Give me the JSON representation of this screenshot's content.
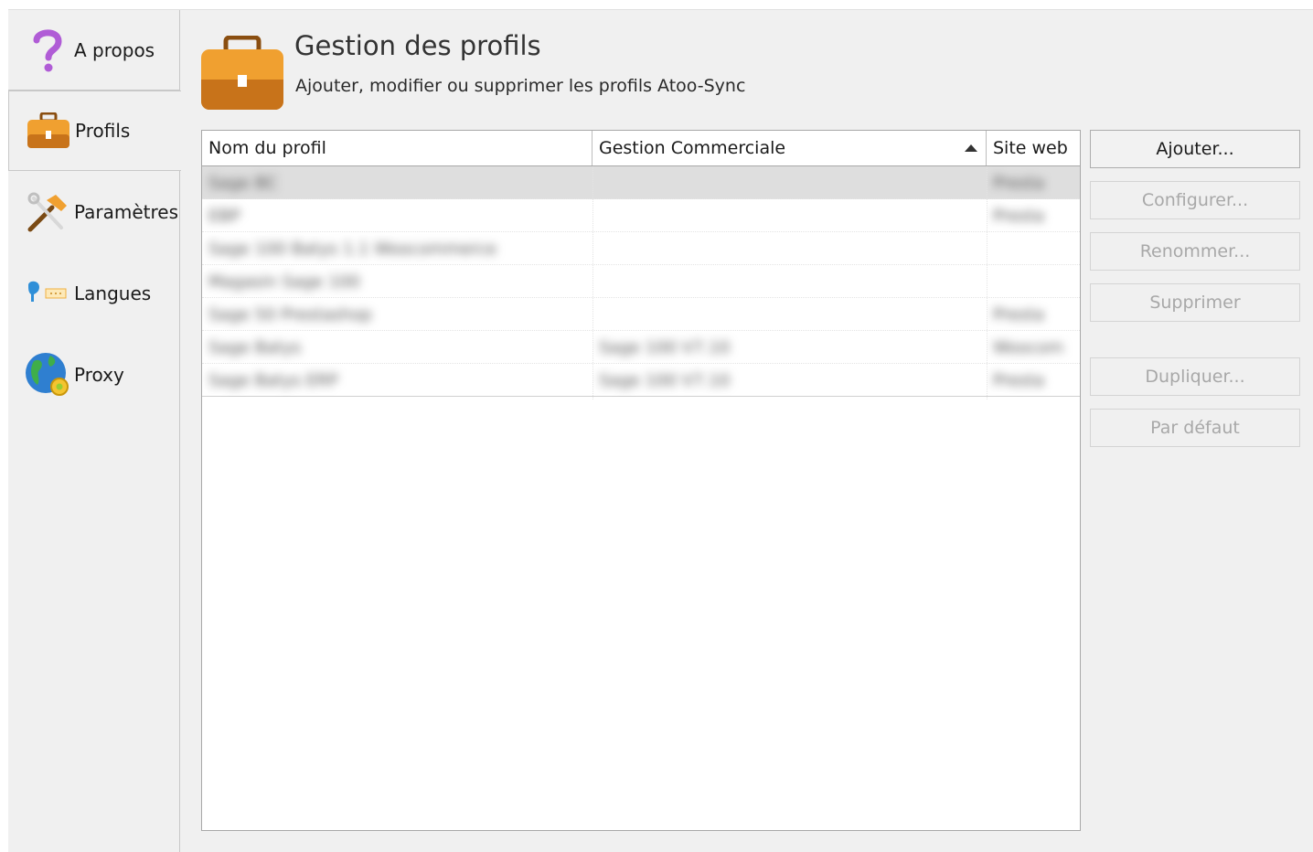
{
  "sidebar": {
    "items": [
      {
        "label": "A propos",
        "icon": "question-icon"
      },
      {
        "label": "Profils",
        "icon": "briefcase-icon",
        "selected": true
      },
      {
        "label": "Paramètres",
        "icon": "tools-icon"
      },
      {
        "label": "Langues",
        "icon": "speech-icon"
      },
      {
        "label": "Proxy",
        "icon": "globe-icon"
      }
    ]
  },
  "header": {
    "title": "Gestion des profils",
    "subtitle": "Ajouter, modifier ou supprimer les profils Atoo-Sync",
    "icon": "briefcase-icon"
  },
  "table": {
    "columns": [
      "Nom du profil",
      "Gestion Commerciale",
      "Site web"
    ],
    "sorted_column": "Gestion Commerciale",
    "sort_direction": "ascending",
    "rows": [
      {
        "name": "Sage BC",
        "gestion": "",
        "site": "Presta",
        "selected": true
      },
      {
        "name": "EBP",
        "gestion": "",
        "site": "Presta"
      },
      {
        "name": "Sage 100 Batys 1.1 Woocommerce",
        "gestion": "",
        "site": ""
      },
      {
        "name": "Magasin Sage 100",
        "gestion": "",
        "site": ""
      },
      {
        "name": "Sage 50 Prestashop",
        "gestion": "",
        "site": "Presta"
      },
      {
        "name": "Sage Batys",
        "gestion": "Sage 100 V7.10",
        "site": "Woocom"
      },
      {
        "name": "Sage Batys ERP",
        "gestion": "Sage 100 V7.10",
        "site": "Presta"
      }
    ]
  },
  "buttons": {
    "add": "Ajouter...",
    "configure": "Configurer...",
    "rename": "Renommer...",
    "delete": "Supprimer",
    "duplicate": "Dupliquer...",
    "default": "Par défaut"
  },
  "colors": {
    "briefcase_orange": "#f0a030",
    "briefcase_dark": "#c8731a",
    "question_purple": "#b05cd6"
  }
}
